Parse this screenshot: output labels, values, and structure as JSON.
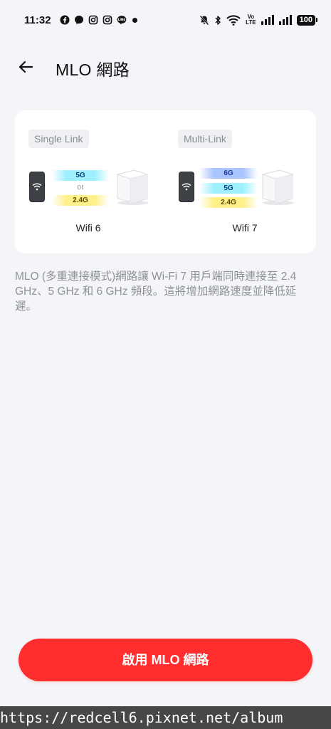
{
  "status_bar": {
    "time": "11:32",
    "volte_top": "Vo",
    "volte_bottom": "LTE",
    "battery": "100",
    "icons": [
      "facebook-icon",
      "messenger-icon",
      "instagram-icon",
      "instagram-icon",
      "line-icon",
      "dot-icon",
      "mute-icon",
      "bluetooth-icon",
      "wifi-icon",
      "signal-icon",
      "signal-icon",
      "battery-icon"
    ]
  },
  "header": {
    "title": "MLO 網路"
  },
  "card": {
    "single": {
      "tag": "Single Link",
      "band_5g": "5G",
      "or": "or",
      "band_24g": "2.4G",
      "label": "Wifi 6"
    },
    "multi": {
      "tag": "Multi-Link",
      "band_6g": "6G",
      "band_5g": "5G",
      "band_24g": "2.4G",
      "label": "Wifi 7"
    }
  },
  "description": "MLO (多重連接模式)網路讓 Wi-Fi 7 用戶端同時連接至 2.4 GHz、5 GHz 和 6 GHz 頻段。這將增加網路速度並降低延遲。",
  "primary_button": {
    "label": "啟用 MLO 網路"
  },
  "watermark": "https://redcell6.pixnet.net/album",
  "colors": {
    "accent": "#ff2d2d",
    "background": "#f4f5f9"
  }
}
